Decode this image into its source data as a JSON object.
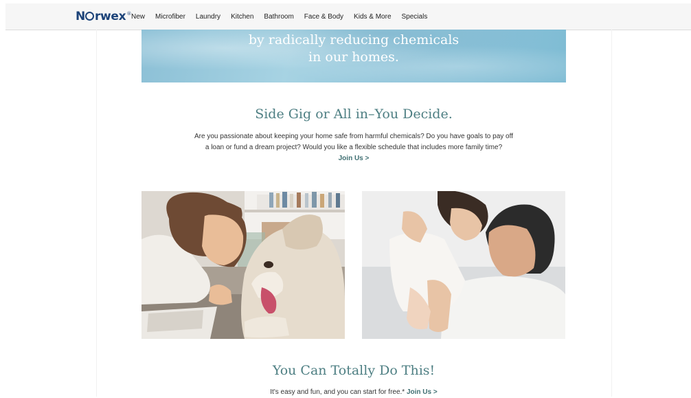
{
  "nav": {
    "logo": {
      "pre": "N",
      "post": "rwex",
      "reg": "®"
    },
    "links": [
      "New",
      "Microfiber",
      "Laundry",
      "Kitchen",
      "Bathroom",
      "Face & Body",
      "Kids & More",
      "Specials"
    ]
  },
  "hero": {
    "line1": "by radically reducing chemicals",
    "line2": "in our homes."
  },
  "section1": {
    "title": "Side Gig or All in–You Decide.",
    "line1": "Are you passionate about keeping your home safe from harmful chemicals? Do you have goals to pay off",
    "line2": "a loan or fund a dream project? Would you like a flexible schedule that includes more family time?",
    "link": "Join Us >"
  },
  "section2": {
    "title": "You Can Totally Do This!",
    "text": "It's easy and fun, and you can start for free.* ",
    "link": "Join Us >"
  },
  "colors": {
    "brand": "#1c4379",
    "accent": "#4e7f83",
    "link": "#3f6f72"
  }
}
